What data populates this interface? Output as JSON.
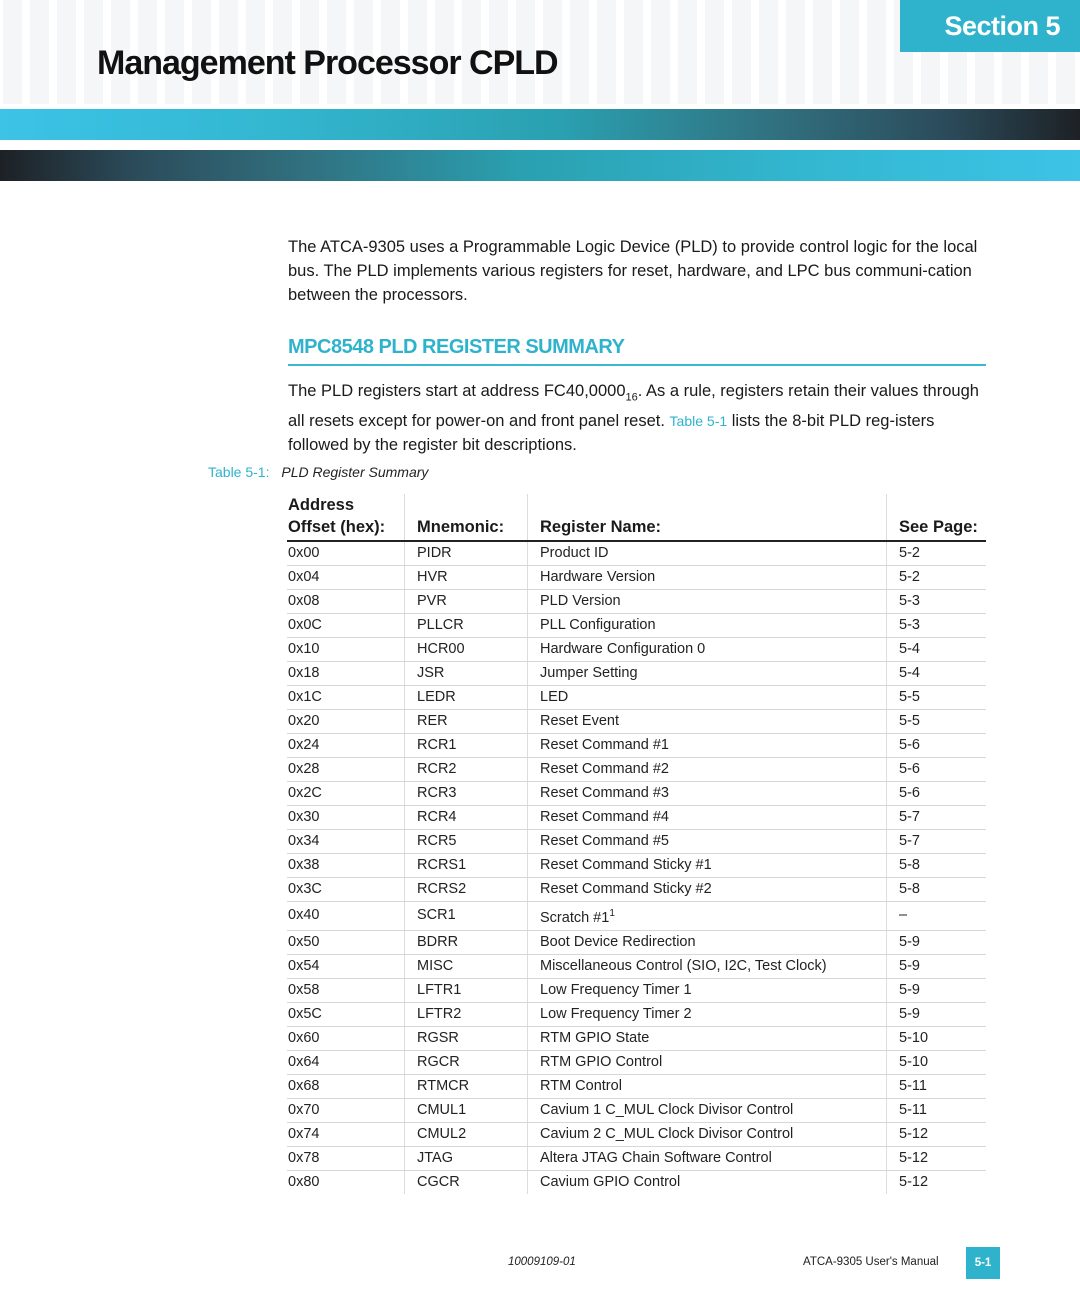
{
  "header": {
    "section_label": "Section 5",
    "page_title": "Management Processor CPLD"
  },
  "intro": "The ATCA-9305 uses a Programmable Logic Device (PLD) to provide control logic for the local bus. The PLD implements various registers for reset, hardware, and LPC bus communi-cation between the processors.",
  "section": {
    "heading": "MPC8548 PLD REGISTER SUMMARY",
    "para_part1": "The PLD registers start at address FC40,0000",
    "para_subscript": "16",
    "para_part2": ". As a rule, registers retain their values through all resets except for power-on and front panel reset. ",
    "para_link": "Table 5-1",
    "para_part3": " lists the 8-bit PLD reg-isters followed by the register bit descriptions."
  },
  "table": {
    "caption_number": "Table 5-1:",
    "caption_title": "PLD Register Summary",
    "headers": {
      "offset_line1": "Address",
      "offset_line2": "Offset (hex):",
      "mnemonic": "Mnemonic:",
      "name": "Register Name:",
      "page": "See Page:"
    },
    "rows": [
      {
        "offset": "0x00",
        "mnemonic": "PIDR",
        "name": "Product ID",
        "page": "5-2"
      },
      {
        "offset": "0x04",
        "mnemonic": "HVR",
        "name": "Hardware Version",
        "page": "5-2"
      },
      {
        "offset": "0x08",
        "mnemonic": "PVR",
        "name": "PLD Version",
        "page": "5-3"
      },
      {
        "offset": "0x0C",
        "mnemonic": "PLLCR",
        "name": "PLL Configuration",
        "page": "5-3"
      },
      {
        "offset": "0x10",
        "mnemonic": "HCR00",
        "name": "Hardware Configuration 0",
        "page": "5-4"
      },
      {
        "offset": "0x18",
        "mnemonic": "JSR",
        "name": "Jumper Setting",
        "page": "5-4"
      },
      {
        "offset": "0x1C",
        "mnemonic": "LEDR",
        "name": "LED",
        "page": "5-5"
      },
      {
        "offset": "0x20",
        "mnemonic": "RER",
        "name": "Reset Event",
        "page": "5-5"
      },
      {
        "offset": "0x24",
        "mnemonic": "RCR1",
        "name": "Reset Command #1",
        "page": "5-6"
      },
      {
        "offset": "0x28",
        "mnemonic": "RCR2",
        "name": "Reset Command #2",
        "page": "5-6"
      },
      {
        "offset": "0x2C",
        "mnemonic": "RCR3",
        "name": "Reset Command #3",
        "page": "5-6"
      },
      {
        "offset": "0x30",
        "mnemonic": "RCR4",
        "name": "Reset Command #4",
        "page": "5-7"
      },
      {
        "offset": "0x34",
        "mnemonic": "RCR5",
        "name": "Reset Command #5",
        "page": "5-7"
      },
      {
        "offset": "0x38",
        "mnemonic": "RCRS1",
        "name": "Reset Command Sticky #1",
        "page": "5-8"
      },
      {
        "offset": "0x3C",
        "mnemonic": "RCRS2",
        "name": "Reset Command Sticky #2",
        "page": "5-8"
      },
      {
        "offset": "0x40",
        "mnemonic": "SCR1",
        "name": "Scratch #1",
        "footnote": "1",
        "page": "–"
      },
      {
        "offset": "0x50",
        "mnemonic": "BDRR",
        "name": "Boot Device Redirection",
        "page": "5-9"
      },
      {
        "offset": "0x54",
        "mnemonic": "MISC",
        "name": "Miscellaneous Control (SIO, I2C, Test Clock)",
        "page": "5-9"
      },
      {
        "offset": "0x58",
        "mnemonic": "LFTR1",
        "name": "Low Frequency Timer 1",
        "page": "5-9"
      },
      {
        "offset": "0x5C",
        "mnemonic": "LFTR2",
        "name": "Low Frequency Timer 2",
        "page": "5-9"
      },
      {
        "offset": "0x60",
        "mnemonic": "RGSR",
        "name": "RTM GPIO State",
        "page": "5-10"
      },
      {
        "offset": "0x64",
        "mnemonic": "RGCR",
        "name": "RTM GPIO Control",
        "page": "5-10"
      },
      {
        "offset": "0x68",
        "mnemonic": "RTMCR",
        "name": "RTM Control",
        "page": "5-11"
      },
      {
        "offset": "0x70",
        "mnemonic": "CMUL1",
        "name": "Cavium 1 C_MUL Clock Divisor Control",
        "page": "5-11"
      },
      {
        "offset": "0x74",
        "mnemonic": "CMUL2",
        "name": "Cavium 2 C_MUL Clock Divisor Control",
        "page": "5-12"
      },
      {
        "offset": "0x78",
        "mnemonic": "JTAG",
        "name": "Altera JTAG Chain Software Control",
        "page": "5-12"
      },
      {
        "offset": "0x80",
        "mnemonic": "CGCR",
        "name": "Cavium GPIO Control",
        "page": "5-12"
      }
    ]
  },
  "footer": {
    "doc_number": "10009109-01",
    "manual_title": "ATCA-9305 User's Manual",
    "page_number": "5-1"
  },
  "colors": {
    "accent": "#2fb3cc",
    "text": "#1a1a1a"
  }
}
